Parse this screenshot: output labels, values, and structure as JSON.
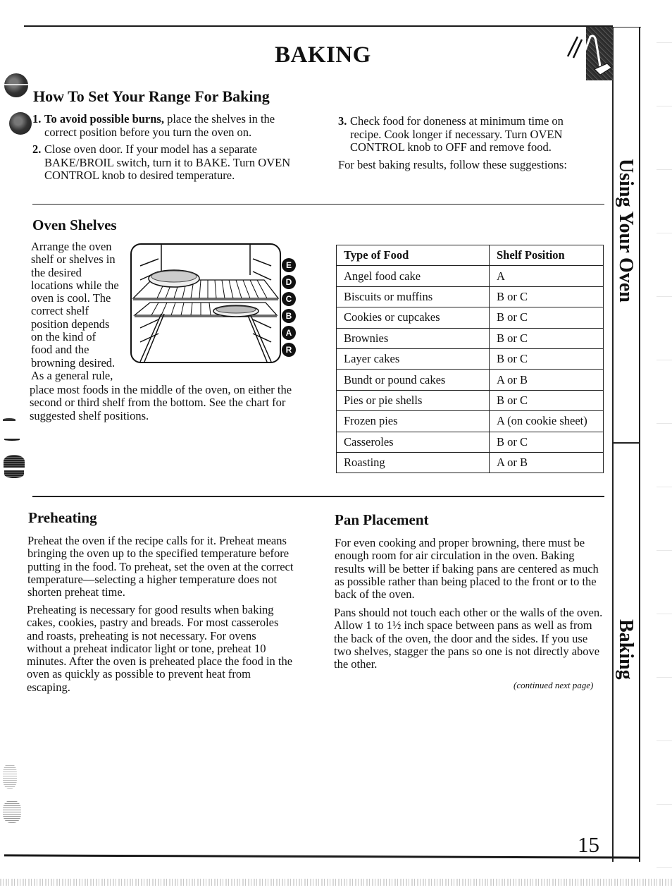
{
  "page": {
    "title": "BAKING",
    "page_number": "15"
  },
  "side_tabs": {
    "section": "Using Your Oven",
    "chapter": "Baking"
  },
  "how_to": {
    "heading": "How To Set Your Range For Baking",
    "steps": [
      {
        "num": "1.",
        "bold": "To avoid possible burns,",
        "text": " place the shelves in the correct position before you turn the oven on."
      },
      {
        "num": "2.",
        "bold": "",
        "text": "Close oven door. If your model has a separate BAKE/BROIL switch, turn it to BAKE. Turn OVEN CONTROL knob to desired temperature."
      },
      {
        "num": "3.",
        "bold": "",
        "text": "Check food for doneness at minimum time on recipe. Cook longer if necessary. Turn OVEN CONTROL knob to OFF and remove food."
      }
    ],
    "suggestion": "For best baking results, follow these suggestions:"
  },
  "oven_shelves": {
    "heading": "Oven Shelves",
    "text_wrapped": "Arrange the oven shelf or shelves in the desired locations while the oven is cool. The correct shelf position depends on the kind of food and the browning desired. As a general rule,",
    "text_continued": "place most foods in the middle of the oven, on either the second or third shelf from the bottom. See the chart for suggested shelf positions.",
    "shelf_labels": [
      "E",
      "D",
      "C",
      "B",
      "A",
      "R"
    ],
    "figure": "oven-shelves-illustration"
  },
  "shelf_table": {
    "headers": [
      "Type of Food",
      "Shelf Position"
    ],
    "rows": [
      [
        "Angel food cake",
        "A"
      ],
      [
        "Biscuits or muffins",
        "B or C"
      ],
      [
        "Cookies or cupcakes",
        "B or C"
      ],
      [
        "Brownies",
        "B or C"
      ],
      [
        "Layer cakes",
        "B or C"
      ],
      [
        "Bundt or pound cakes",
        "A or B"
      ],
      [
        "Pies or pie shells",
        "B or C"
      ],
      [
        "Frozen pies",
        "A (on cookie sheet)"
      ],
      [
        "Casseroles",
        "B or C"
      ],
      [
        "Roasting",
        "A or B"
      ]
    ]
  },
  "preheating": {
    "heading": "Preheating",
    "paragraphs": [
      "Preheat the oven if the recipe calls for it. Preheat means bringing the oven up to the specified temperature before putting in the food. To preheat, set the oven at the correct temperature—selecting a higher temperature does not shorten preheat time.",
      "Preheating is necessary for good results when baking cakes, cookies, pastry and breads. For most casseroles and roasts, preheating is not necessary. For ovens without a preheat indicator light or tone, preheat 10 minutes. After the oven is preheated place the food in the oven as quickly as possible to prevent heat from escaping."
    ]
  },
  "pan_placement": {
    "heading": "Pan Placement",
    "paragraphs": [
      "For even cooking and proper browning, there must be enough room for air circulation in the oven. Baking results will be better if baking pans are centered as much as possible rather than being placed to the front or to the back of the oven.",
      "Pans should not touch each other or the walls of the oven. Allow 1 to 1½ inch space between pans as well as from the back of the oven, the door and the sides. If you use two shelves, stagger the pans so one is not directly above the other."
    ],
    "continued": "(continued next page)"
  }
}
